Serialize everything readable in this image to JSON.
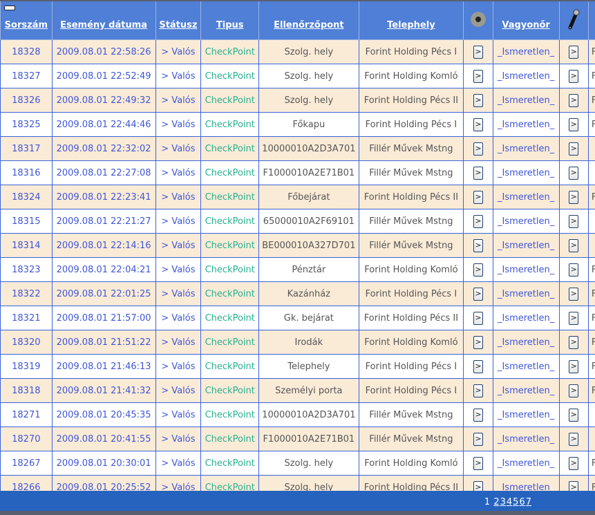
{
  "headers": {
    "sorszam": "Sorszám",
    "datum": "Esemény dátuma",
    "status": "Státusz",
    "tipus": "Tipus",
    "ellenorzopont": "Ellenőrzőpont",
    "telephely": "Telephely",
    "chip_icon": "disc-reader-icon",
    "vagyonor": "Vagyonőr",
    "key_icon": "ibutton-key-icon"
  },
  "button_label": ">",
  "rows": [
    {
      "id": "18328",
      "date": "2009.08.01 22:58:26",
      "status": "> Valós",
      "type": "CheckPoint",
      "point": "Szolg. hely",
      "site": "Forint Holding Pécs I",
      "guard": "_Ismeretlen_",
      "extra": "F"
    },
    {
      "id": "18327",
      "date": "2009.08.01 22:52:49",
      "status": "> Valós",
      "type": "CheckPoint",
      "point": "Szolg. hely",
      "site": "Forint Holding Komló",
      "guard": "_Ismeretlen_",
      "extra": "F"
    },
    {
      "id": "18326",
      "date": "2009.08.01 22:49:32",
      "status": "> Valós",
      "type": "CheckPoint",
      "point": "Szolg. hely",
      "site": "Forint Holding Pécs II",
      "guard": "_Ismeretlen_",
      "extra": "F"
    },
    {
      "id": "18325",
      "date": "2009.08.01 22:44:46",
      "status": "> Valós",
      "type": "CheckPoint",
      "point": "Főkapu",
      "site": "Forint Holding Pécs I",
      "guard": "_Ismeretlen_",
      "extra": "F"
    },
    {
      "id": "18317",
      "date": "2009.08.01 22:32:02",
      "status": "> Valós",
      "type": "CheckPoint",
      "point": "10000010A2D3A701",
      "site": "Fillér Művek Mstng",
      "guard": "_Ismeretlen_",
      "extra": ""
    },
    {
      "id": "18316",
      "date": "2009.08.01 22:27:08",
      "status": "> Valós",
      "type": "CheckPoint",
      "point": "F1000010A2E71B01",
      "site": "Fillér Művek Mstng",
      "guard": "_Ismeretlen_",
      "extra": ""
    },
    {
      "id": "18324",
      "date": "2009.08.01 22:23:41",
      "status": "> Valós",
      "type": "CheckPoint",
      "point": "Főbejárat",
      "site": "Forint Holding Pécs II",
      "guard": "_Ismeretlen_",
      "extra": "F"
    },
    {
      "id": "18315",
      "date": "2009.08.01 22:21:27",
      "status": "> Valós",
      "type": "CheckPoint",
      "point": "65000010A2F69101",
      "site": "Fillér Művek Mstng",
      "guard": "_Ismeretlen_",
      "extra": ""
    },
    {
      "id": "18314",
      "date": "2009.08.01 22:14:16",
      "status": "> Valós",
      "type": "CheckPoint",
      "point": "BE000010A327D701",
      "site": "Fillér Művek Mstng",
      "guard": "_Ismeretlen_",
      "extra": ""
    },
    {
      "id": "18323",
      "date": "2009.08.01 22:04:21",
      "status": "> Valós",
      "type": "CheckPoint",
      "point": "Pénztár",
      "site": "Forint Holding Komló",
      "guard": "_Ismeretlen_",
      "extra": "F"
    },
    {
      "id": "18322",
      "date": "2009.08.01 22:01:25",
      "status": "> Valós",
      "type": "CheckPoint",
      "point": "Kazánház",
      "site": "Forint Holding Pécs I",
      "guard": "_Ismeretlen_",
      "extra": "F"
    },
    {
      "id": "18321",
      "date": "2009.08.01 21:57:00",
      "status": "> Valós",
      "type": "CheckPoint",
      "point": "Gk. bejárat",
      "site": "Forint Holding Pécs II",
      "guard": "_Ismeretlen_",
      "extra": "F"
    },
    {
      "id": "18320",
      "date": "2009.08.01 21:51:22",
      "status": "> Valós",
      "type": "CheckPoint",
      "point": "Irodák",
      "site": "Forint Holding Komló",
      "guard": "_Ismeretlen_",
      "extra": "F"
    },
    {
      "id": "18319",
      "date": "2009.08.01 21:46:13",
      "status": "> Valós",
      "type": "CheckPoint",
      "point": "Telephely",
      "site": "Forint Holding Pécs I",
      "guard": "_Ismeretlen_",
      "extra": "F"
    },
    {
      "id": "18318",
      "date": "2009.08.01 21:41:32",
      "status": "> Valós",
      "type": "CheckPoint",
      "point": "Személyi porta",
      "site": "Forint Holding Pécs I",
      "guard": "_Ismeretlen_",
      "extra": "F"
    },
    {
      "id": "18271",
      "date": "2009.08.01 20:45:35",
      "status": "> Valós",
      "type": "CheckPoint",
      "point": "10000010A2D3A701",
      "site": "Fillér Művek Mstng",
      "guard": "_Ismeretlen_",
      "extra": ""
    },
    {
      "id": "18270",
      "date": "2009.08.01 20:41:55",
      "status": "> Valós",
      "type": "CheckPoint",
      "point": "F1000010A2E71B01",
      "site": "Fillér Művek Mstng",
      "guard": "_Ismeretlen_",
      "extra": ""
    },
    {
      "id": "18267",
      "date": "2009.08.01 20:30:01",
      "status": "> Valós",
      "type": "CheckPoint",
      "point": "Szolg. hely",
      "site": "Forint Holding Komló",
      "guard": "_Ismeretlen_",
      "extra": "F"
    },
    {
      "id": "18266",
      "date": "2009.08.01 20:25:52",
      "status": "> Valós",
      "type": "CheckPoint",
      "point": "Szolg. hely",
      "site": "Forint Holding Pécs II",
      "guard": "_Ismeretlen_",
      "extra": "F"
    }
  ],
  "pagination": {
    "current": "1",
    "pages": [
      "2",
      "3",
      "4",
      "5",
      "6",
      "7"
    ]
  }
}
